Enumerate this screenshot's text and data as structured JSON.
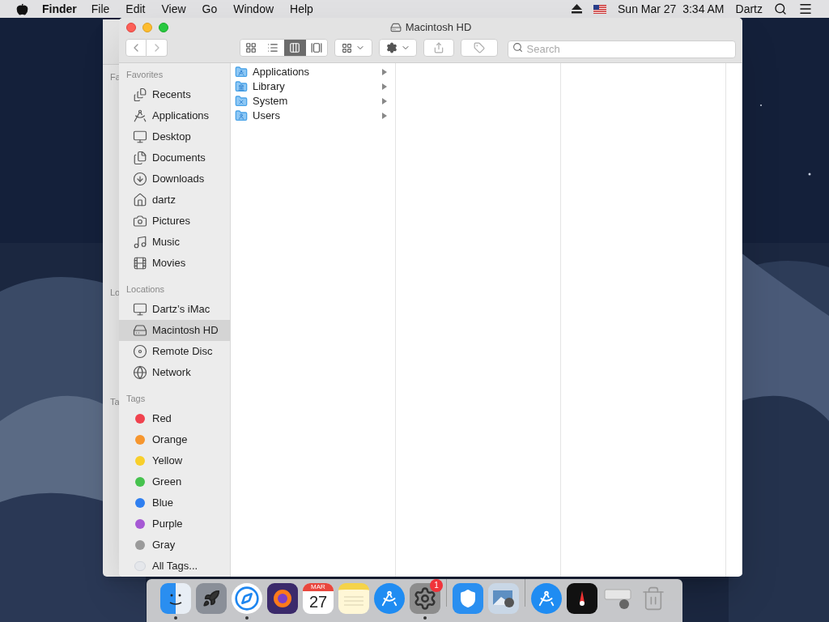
{
  "menubar": {
    "app": "Finder",
    "menus": [
      "File",
      "Edit",
      "View",
      "Go",
      "Window",
      "Help"
    ],
    "clock": "Sun Mar 27  3:34 AM",
    "user": "Dartz"
  },
  "back_window": {
    "labels": [
      "Fa",
      "Lo",
      "Ta"
    ]
  },
  "window": {
    "title": "Macintosh HD",
    "view_modes": [
      {
        "kind": "icons",
        "selected": false
      },
      {
        "kind": "list",
        "selected": false
      },
      {
        "kind": "columns",
        "selected": true
      },
      {
        "kind": "gallery",
        "selected": false
      }
    ],
    "search": {
      "placeholder": "Search"
    },
    "sidebar": [
      {
        "title": "Favorites",
        "items": [
          {
            "kind": "recents",
            "label": "Recents",
            "selected": false
          },
          {
            "kind": "applications",
            "label": "Applications",
            "selected": false
          },
          {
            "kind": "desktop",
            "label": "Desktop",
            "selected": false
          },
          {
            "kind": "documents",
            "label": "Documents",
            "selected": false
          },
          {
            "kind": "downloads",
            "label": "Downloads",
            "selected": false
          },
          {
            "kind": "home",
            "label": "dartz",
            "selected": false
          },
          {
            "kind": "pictures",
            "label": "Pictures",
            "selected": false
          },
          {
            "kind": "music",
            "label": "Music",
            "selected": false
          },
          {
            "kind": "movies",
            "label": "Movies",
            "selected": false
          }
        ]
      },
      {
        "title": "Locations",
        "items": [
          {
            "kind": "computer",
            "label": "Dartz’s iMac",
            "selected": false
          },
          {
            "kind": "disk",
            "label": "Macintosh HD",
            "selected": true
          },
          {
            "kind": "disc",
            "label": "Remote Disc",
            "selected": false
          },
          {
            "kind": "network",
            "label": "Network",
            "selected": false
          }
        ]
      },
      {
        "title": "Tags",
        "items": [
          {
            "kind": "tag",
            "label": "Red",
            "color": "#f0424e",
            "selected": false
          },
          {
            "kind": "tag",
            "label": "Orange",
            "color": "#f6962e",
            "selected": false
          },
          {
            "kind": "tag",
            "label": "Yellow",
            "color": "#f8cf2b",
            "selected": false
          },
          {
            "kind": "tag",
            "label": "Green",
            "color": "#46c24e",
            "selected": false
          },
          {
            "kind": "tag",
            "label": "Blue",
            "color": "#2f7ff0",
            "selected": false
          },
          {
            "kind": "tag",
            "label": "Purple",
            "color": "#a659d4",
            "selected": false
          },
          {
            "kind": "tag",
            "label": "Gray",
            "color": "#9a9a9a",
            "selected": false
          },
          {
            "kind": "all_tags",
            "label": "All Tags...",
            "selected": false
          }
        ]
      }
    ],
    "columns": [
      [
        {
          "name": "Applications",
          "kind": "applications"
        },
        {
          "name": "Library",
          "kind": "library"
        },
        {
          "name": "System",
          "kind": "system"
        },
        {
          "name": "Users",
          "kind": "users"
        }
      ],
      [],
      [],
      []
    ]
  },
  "dock": [
    {
      "kind": "finder",
      "running": true
    },
    {
      "kind": "launchpad",
      "running": false
    },
    {
      "kind": "safari",
      "running": true
    },
    {
      "kind": "firefox",
      "running": false
    },
    {
      "kind": "calendar",
      "running": false,
      "month": "MAR",
      "day": "27"
    },
    {
      "kind": "notes",
      "running": false
    },
    {
      "kind": "appstore",
      "running": false
    },
    {
      "kind": "settings",
      "running": true,
      "badge": "1"
    },
    {
      "kind": "separator"
    },
    {
      "kind": "shield",
      "running": false
    },
    {
      "kind": "preview",
      "running": false
    },
    {
      "kind": "separator"
    },
    {
      "kind": "appstore",
      "running": false
    },
    {
      "kind": "gauge",
      "running": false
    },
    {
      "kind": "installer",
      "running": false
    },
    {
      "kind": "trash",
      "running": false
    }
  ]
}
